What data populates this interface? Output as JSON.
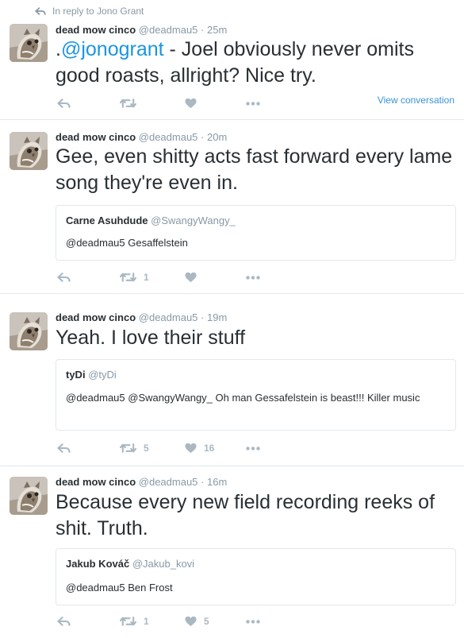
{
  "context": {
    "reply_label": "In reply to Jono Grant"
  },
  "tweets": [
    {
      "name": "dead mow cinco",
      "handle": "@deadmau5",
      "time": "25m",
      "text_prefix": ".",
      "mention": "@jonogrant",
      "text": " - Joel obviously never omits good roasts, allright? Nice try.",
      "view_conversation": "View conversation",
      "retweets": "",
      "likes": ""
    },
    {
      "name": "dead mow cinco",
      "handle": "@deadmau5",
      "time": "20m",
      "text": "Gee, even shitty acts fast forward every lame song they're even in.",
      "quote": {
        "name": "Carne Asuhdude",
        "handle": "@SwangyWangy_",
        "text": "@deadmau5 Gesaffelstein"
      },
      "retweets": "1",
      "likes": ""
    },
    {
      "name": "dead mow cinco",
      "handle": "@deadmau5",
      "time": "19m",
      "text": "Yeah. I love their stuff",
      "quote": {
        "name": "tyDi",
        "handle": "@tyDi",
        "text": "@deadmau5 @SwangyWangy_ Oh man Gessafelstein is beast!!! Killer music"
      },
      "retweets": "5",
      "likes": "16"
    },
    {
      "name": "dead mow cinco",
      "handle": "@deadmau5",
      "time": "16m",
      "text": "Because every new field recording reeks of shit. Truth.",
      "quote": {
        "name": "Jakub Kováč",
        "handle": "@Jakub_kovi",
        "text": "@deadmau5 Ben Frost"
      },
      "retweets": "1",
      "likes": "5"
    }
  ],
  "colors": {
    "link": "#1b95e0",
    "muted": "#8899a6",
    "action": "#aab8c2"
  }
}
